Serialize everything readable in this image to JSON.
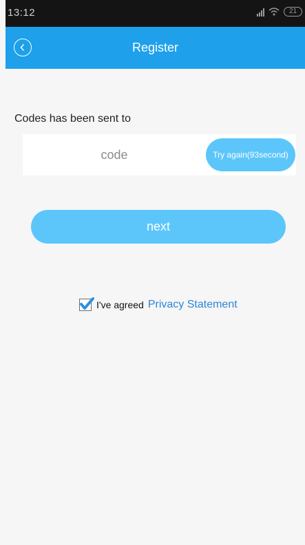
{
  "status_bar": {
    "time": "13:12",
    "battery_level": "21"
  },
  "header": {
    "title": "Register",
    "background": "#1ea0ea",
    "back_icon": "chevron-left-icon"
  },
  "verification": {
    "sent_text": "Codes has been sent to",
    "code_placeholder": "code",
    "code_value": "",
    "retry_label": "Try again(93second)"
  },
  "actions": {
    "next_label": "next",
    "accent": "#5cc6fb"
  },
  "agreement": {
    "checked": true,
    "label": "I've agreed",
    "link_text": "Privacy Statement",
    "link_color": "#2a87d8"
  }
}
